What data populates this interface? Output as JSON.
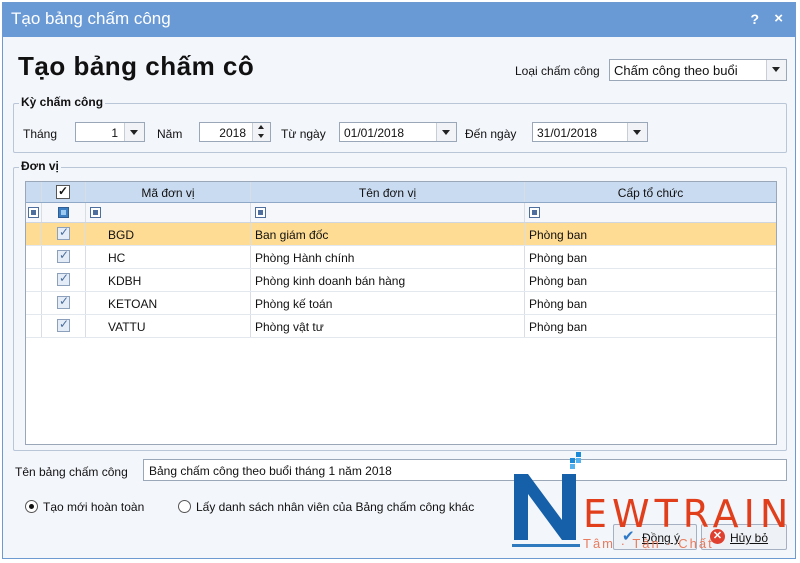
{
  "window": {
    "title": "Tạo bảng chấm công",
    "help": "?",
    "close": "×"
  },
  "heading": "Tạo bảng chấm cô",
  "loai": {
    "label": "Loại chấm công",
    "value": "Chấm công theo buổi"
  },
  "ky": {
    "title": "Kỳ chấm công",
    "thang_label": "Tháng",
    "thang_value": "1",
    "nam_label": "Năm",
    "nam_value": "2018",
    "tu_label": "Từ ngày",
    "tu_value": "01/01/2018",
    "den_label": "Đến ngày",
    "den_value": "31/01/2018"
  },
  "donvi": {
    "title": "Đơn vị",
    "columns": [
      "Mã đơn vị",
      "Tên đơn vị",
      "Cấp tổ chức"
    ],
    "rows": [
      {
        "ma": "BGD",
        "ten": "Ban giám đốc",
        "cap": "Phòng ban"
      },
      {
        "ma": "HC",
        "ten": "Phòng Hành chính",
        "cap": "Phòng ban"
      },
      {
        "ma": "KDBH",
        "ten": "Phòng kinh doanh bán hàng",
        "cap": "Phòng ban"
      },
      {
        "ma": "KETOAN",
        "ten": "Phòng kế toán",
        "cap": "Phòng ban"
      },
      {
        "ma": "VATTU",
        "ten": "Phòng vật tư",
        "cap": "Phòng ban"
      }
    ]
  },
  "ten_bang": {
    "label": "Tên bảng chấm công",
    "value": "Bảng chấm công theo buổi tháng 1 năm 2018"
  },
  "options": {
    "opt1": "Tạo mới hoàn toàn",
    "opt2": "Lấy danh sách nhân viên của Bảng chấm công khác"
  },
  "buttons": {
    "ok": "Đồng ý",
    "cancel": "Hủy bỏ"
  },
  "logo": {
    "letter": "N",
    "word": "EWTRAIN",
    "slogan": "Tâm · Tận · Chất"
  },
  "colors": {
    "titlebar": "#6a9ad6",
    "selected_row": "#ffdc93",
    "header": "#c9dbf1",
    "logo_red": "#e13f1c",
    "logo_blue": "#1560a8"
  }
}
